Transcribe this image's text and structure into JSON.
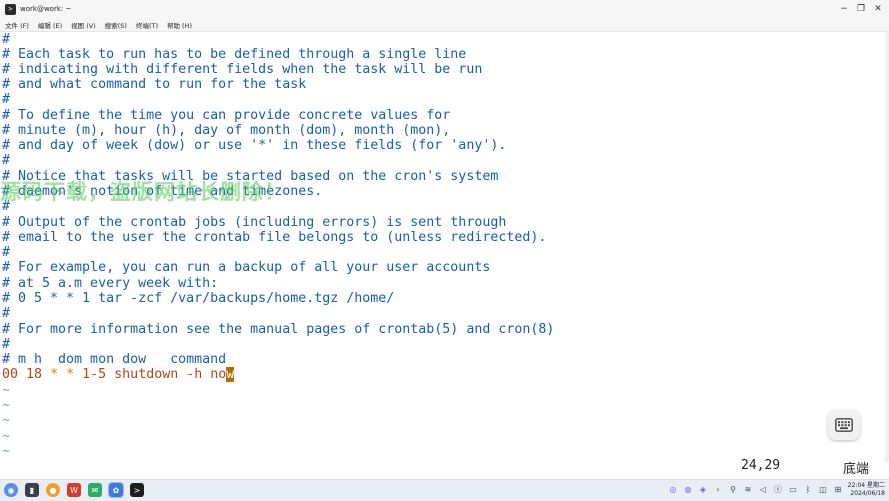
{
  "window": {
    "title": "work@work: ~",
    "icon": "terminal-icon",
    "minimize_glyph": "−",
    "restore_glyph": "❐",
    "close_glyph": "✕"
  },
  "menu": [
    "文件 (F)",
    "编辑 (E)",
    "视图 (V)",
    "搜索(S)",
    "终端(T)",
    "帮助 (H)"
  ],
  "editor": {
    "lines": [
      "#",
      "# Each task to run has to be defined through a single line",
      "# indicating with different fields when the task will be run",
      "# and what command to run for the task",
      "#",
      "# To define the time you can provide concrete values for",
      "# minute (m), hour (h), day of month (dom), month (mon),",
      "# and day of week (dow) or use '*' in these fields (for 'any').",
      "#",
      "# Notice that tasks will be started based on the cron's system",
      "# daemon's notion of time and timezones.",
      "#",
      "# Output of the crontab jobs (including errors) is sent through",
      "# email to the user the crontab file belongs to (unless redirected).",
      "#",
      "# For example, you can run a backup of all your user accounts",
      "# at 5 a.m every week with:",
      "# 0 5 * * 1 tar -zcf /var/backups/home.tgz /home/",
      "#",
      "# For more information see the manual pages of crontab(5) and cron(8)",
      "#",
      "# m h  dom mon dow   command"
    ],
    "cron_line": {
      "minute": "00",
      "hour": "18",
      "dom": "*",
      "mon": "*",
      "dow": "1-5",
      "command_before_cursor": "shutdown -h no",
      "cursor_char": "w"
    },
    "tilde_lines": [
      "~",
      "~",
      "~",
      "~",
      "~"
    ],
    "status_position": "24,29",
    "status_scroll": "底端"
  },
  "watermark": "源码下载，盗版网站长删除！",
  "taskbar": {
    "apps": [
      "kylin-start",
      "file-manager",
      "browser",
      "wps",
      "wechat",
      "software-store",
      "terminal"
    ],
    "clock_time": "22:04 星期二",
    "clock_date": "2024/06/18"
  },
  "colors": {
    "comment": "#1a5ea8",
    "number": "#b0471a",
    "star": "#b8860b",
    "cursor": "#b07000",
    "tilde": "#7aa3c9"
  }
}
